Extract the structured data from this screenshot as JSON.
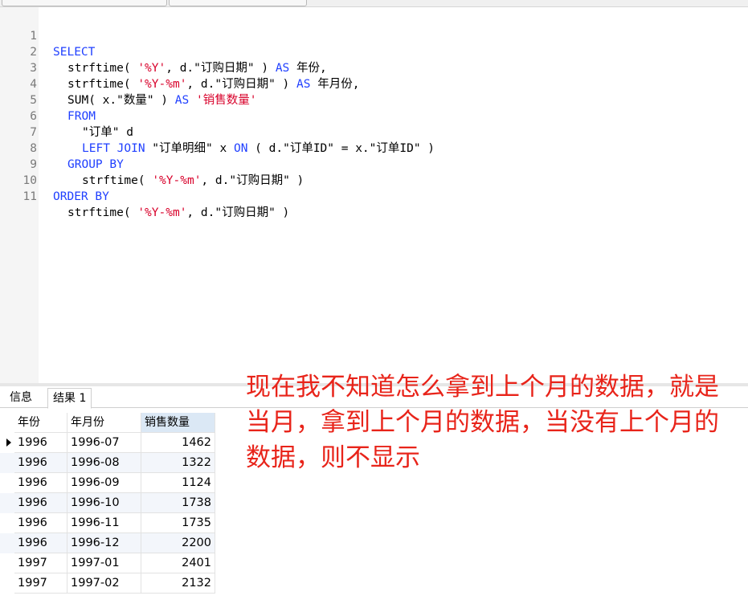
{
  "editor": {
    "line_numbers": [
      "1",
      "2",
      "3",
      "4",
      "5",
      "6",
      "7",
      "8",
      "9",
      "10",
      "11"
    ]
  },
  "sql": {
    "l1_kw": "SELECT",
    "l2_a": "strftime( ",
    "l2_str": "'%Y'",
    "l2_b": ", d.\"订购日期\" ) ",
    "l2_kw": "AS",
    "l2_c": " 年份,",
    "l3_a": "strftime( ",
    "l3_str": "'%Y-%m'",
    "l3_b": ", d.\"订购日期\" ) ",
    "l3_kw": "AS",
    "l3_c": " 年月份,",
    "l4_a": "SUM( x.\"数量\" ) ",
    "l4_kw": "AS",
    "l4_sp": " ",
    "l4_str": "'销售数量'",
    "l5_kw": "FROM",
    "l6_a": "\"订单\" d",
    "l7_kw1": "LEFT JOIN",
    "l7_a": " \"订单明细\" x ",
    "l7_kw2": "ON",
    "l7_b": " ( d.\"订单ID\" = x.\"订单ID\" )",
    "l8_kw": "GROUP BY",
    "l9_a": "strftime( ",
    "l9_str": "'%Y-%m'",
    "l9_b": ", d.\"订购日期\" )",
    "l10_kw": "ORDER BY",
    "l11_a": "strftime( ",
    "l11_str": "'%Y-%m'",
    "l11_b": ", d.\"订购日期\" )"
  },
  "result_tabs": {
    "info": "信息",
    "result1": "结果 1"
  },
  "grid": {
    "columns": [
      "年份",
      "年月份",
      "销售数量"
    ],
    "rows": [
      [
        "1996",
        "1996-07",
        "1462"
      ],
      [
        "1996",
        "1996-08",
        "1322"
      ],
      [
        "1996",
        "1996-09",
        "1124"
      ],
      [
        "1996",
        "1996-10",
        "1738"
      ],
      [
        "1996",
        "1996-11",
        "1735"
      ],
      [
        "1996",
        "1996-12",
        "2200"
      ],
      [
        "1997",
        "1997-01",
        "2401"
      ],
      [
        "1997",
        "1997-02",
        "2132"
      ]
    ]
  },
  "annotation": {
    "text": "现在我不知道怎么拿到上个月的数据，就是当月，拿到上个月的数据，当没有上个月的数据，则不显示",
    "color": "#e8241a"
  },
  "colors": {
    "keyword": "#1f3fff",
    "string": "#d8002a",
    "line_number": "#7a7a7a"
  }
}
